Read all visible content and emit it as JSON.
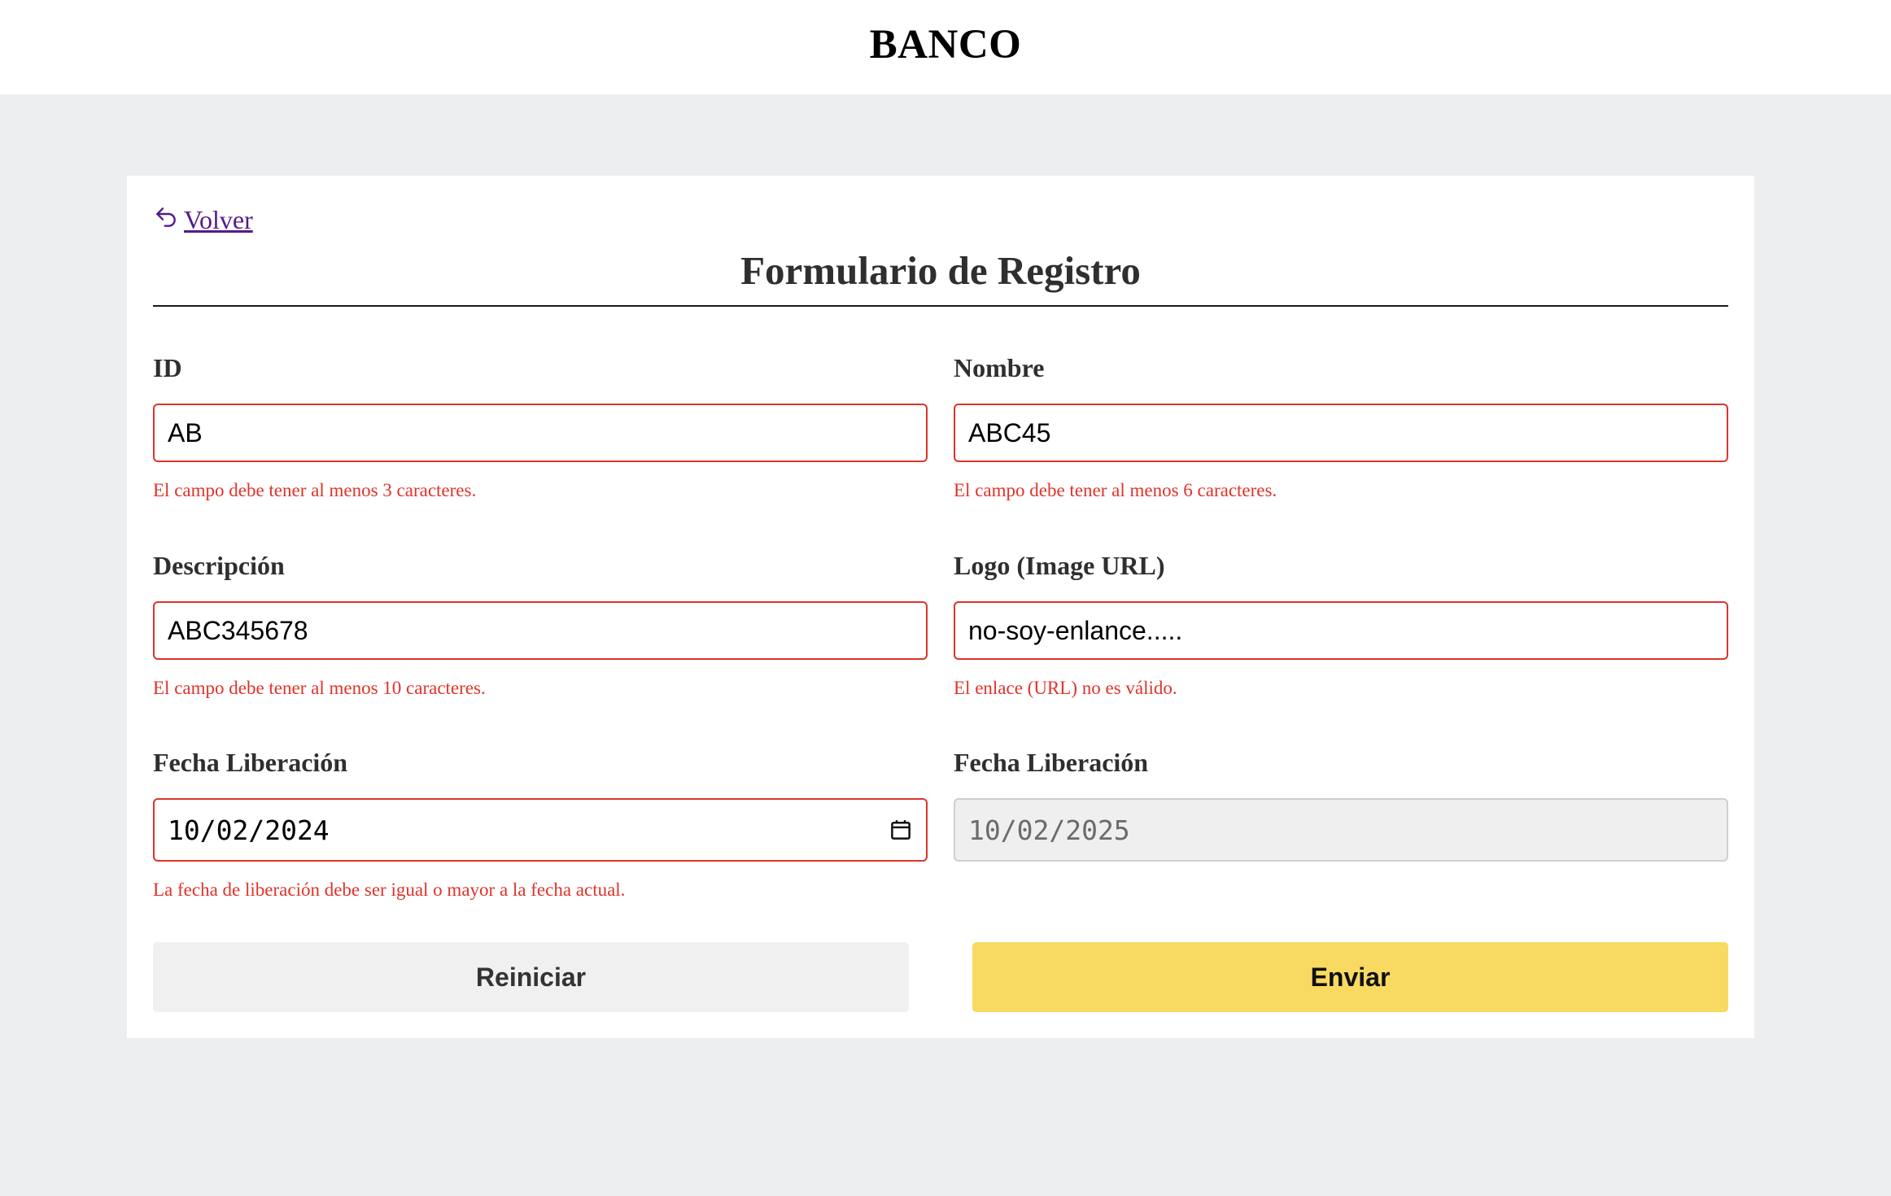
{
  "header": {
    "brand": "BANCO"
  },
  "form": {
    "back_label": " Volver",
    "title": "Formulario de Registro",
    "fields": {
      "id": {
        "label": "ID",
        "value": "AB",
        "error": "El campo debe tener al menos 3 caracteres."
      },
      "nombre": {
        "label": "Nombre",
        "value": "ABC45",
        "error": "El campo debe tener al menos 6 caracteres."
      },
      "descripcion": {
        "label": "Descripción",
        "value": "ABC345678",
        "error": "El campo debe tener al menos 10 caracteres."
      },
      "logo": {
        "label": "Logo (Image URL)",
        "value": "no-soy-enlance.....",
        "error": "El enlace (URL) no es válido."
      },
      "fecha_liberacion": {
        "label": "Fecha Liberación",
        "value": "10/02/2024",
        "error": "La fecha de liberación debe ser igual o mayor a la fecha actual."
      },
      "fecha_revision": {
        "label": "Fecha Liberación",
        "value": "10/02/2025"
      }
    },
    "buttons": {
      "reset": "Reiniciar",
      "submit": "Enviar"
    }
  },
  "colors": {
    "page_bg": "#eceef0",
    "error": "#e0332a",
    "submit_bg": "#f8da62",
    "reset_bg": "#f0f0f0",
    "link": "#551a8b"
  }
}
